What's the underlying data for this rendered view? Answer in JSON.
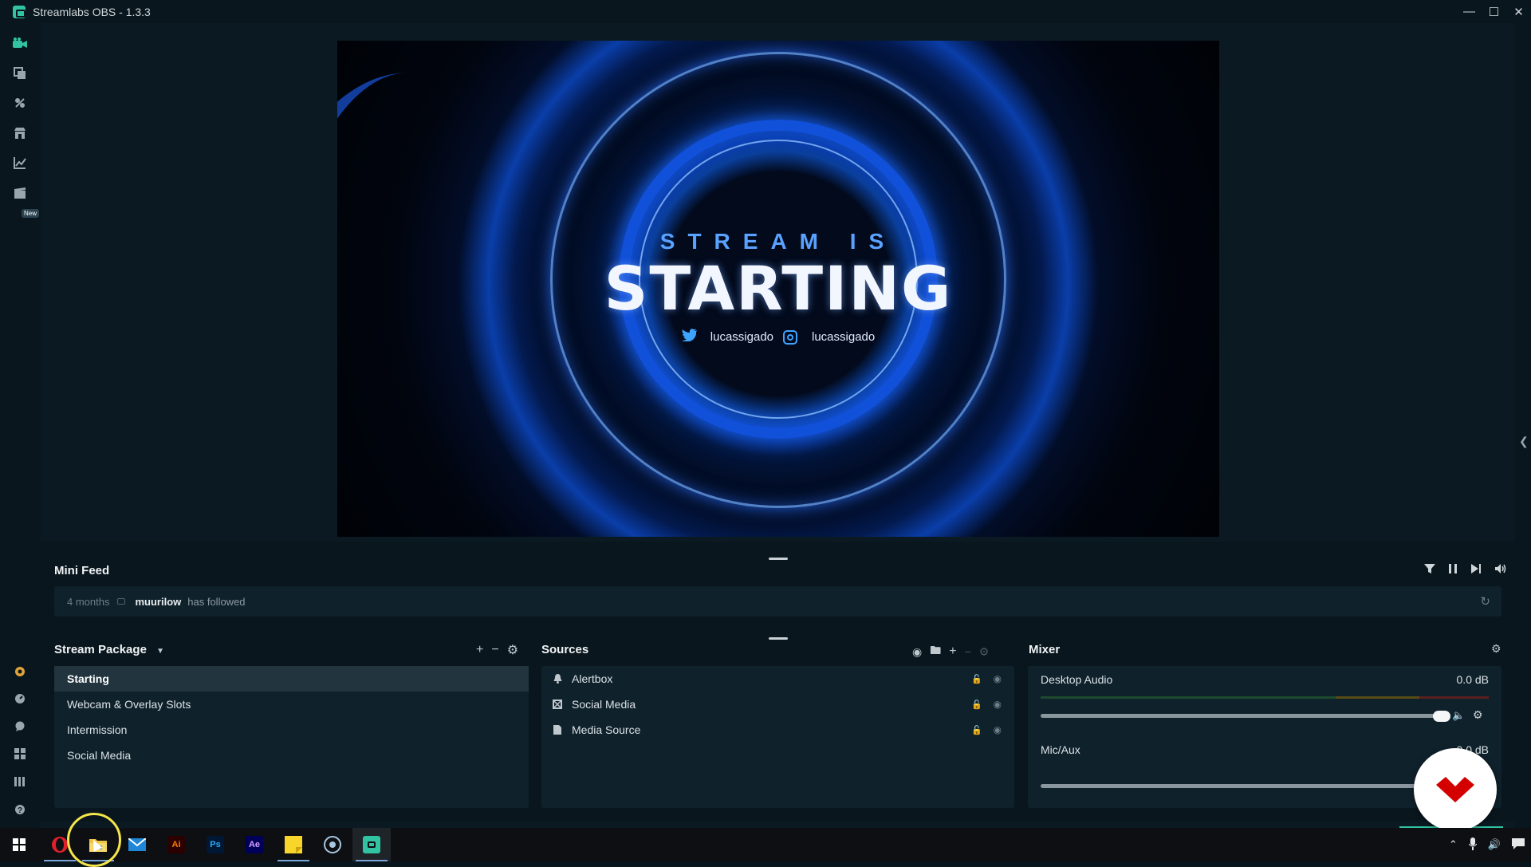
{
  "window": {
    "title": "Streamlabs OBS - 1.3.3",
    "controls": [
      "—",
      "☐",
      "✕"
    ]
  },
  "rail": {
    "new_badge": "New"
  },
  "preview": {
    "line1": "STREAM IS",
    "line2": "STARTING",
    "twitter_handle": "lucassigado",
    "instagram_handle": "lucassigado"
  },
  "minifeed": {
    "title": "Mini Feed",
    "events": [
      {
        "time": "4 months",
        "user": "muurilow",
        "action": "has followed"
      }
    ]
  },
  "scenes": {
    "title": "Stream Package",
    "items": [
      "Starting",
      "Webcam & Overlay Slots",
      "Intermission",
      "Social Media"
    ],
    "selected": "Starting"
  },
  "sources": {
    "title": "Sources",
    "items": [
      {
        "name": "Alertbox",
        "icon": "bell-icon"
      },
      {
        "name": "Social Media",
        "icon": "widget-icon"
      },
      {
        "name": "Media Source",
        "icon": "file-icon"
      }
    ]
  },
  "mixer": {
    "title": "Mixer",
    "channels": [
      {
        "name": "Desktop Audio",
        "db": "0.0 dB",
        "volume": 1.0
      },
      {
        "name": "Mic/Aux",
        "db": "0.0 dB",
        "volume": 1.0
      }
    ]
  },
  "colors": {
    "accent": "#31c3a2",
    "background": "#09161d",
    "panel": "#0f212b"
  }
}
